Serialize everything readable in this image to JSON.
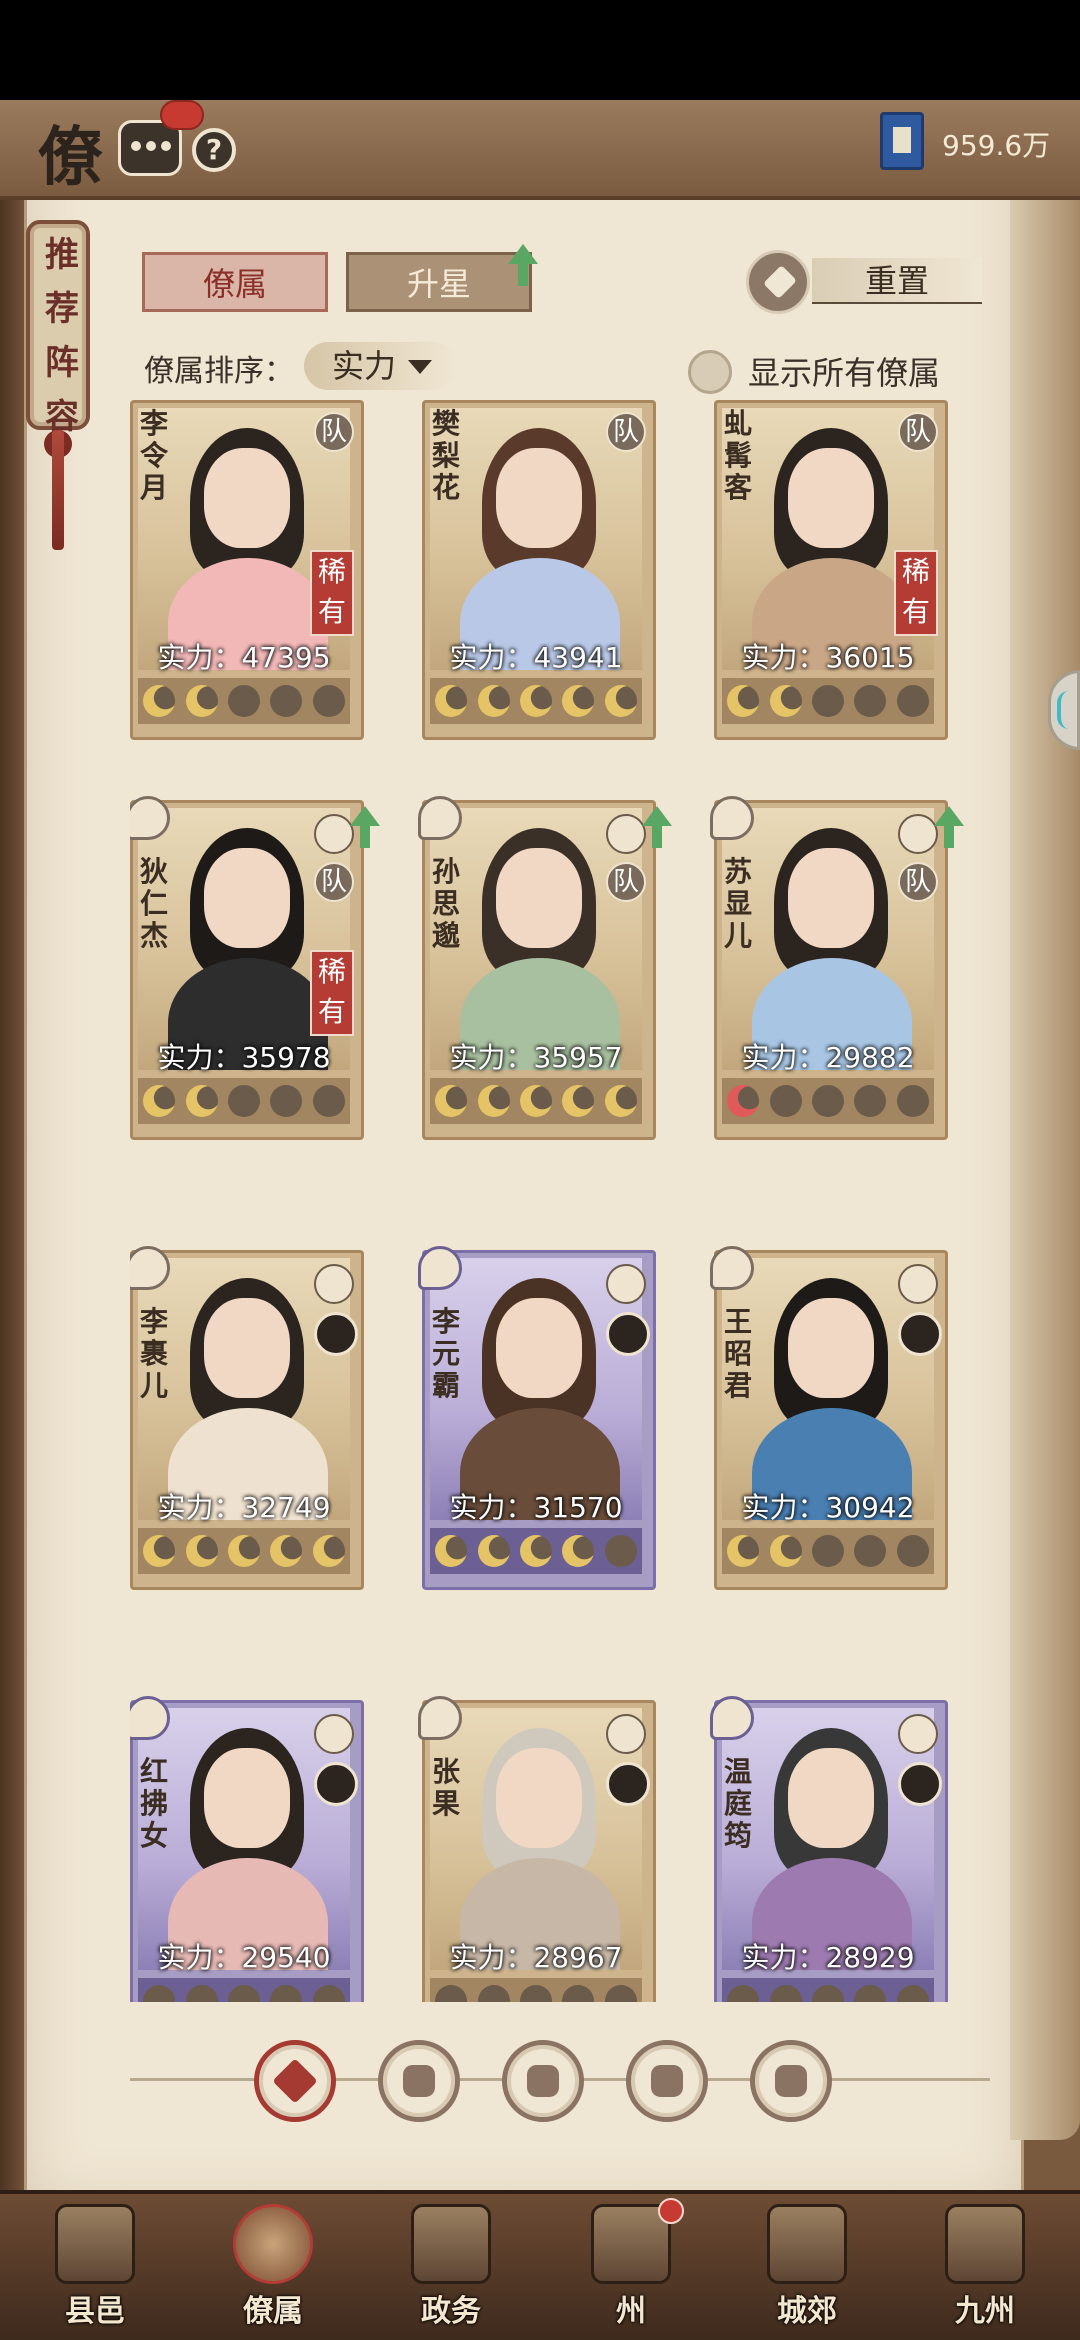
{
  "header": {
    "title": "僚",
    "currency_value": "959.6万"
  },
  "recommend_tab": {
    "chars": [
      "推",
      "荐",
      "阵",
      "容"
    ]
  },
  "tabs": {
    "active": "僚属",
    "inactive": "升星"
  },
  "reset_label": "重置",
  "sort": {
    "label": "僚属排序：",
    "value": "实力"
  },
  "show_all_label": "显示所有僚属",
  "cards": [
    {
      "name": "李令月",
      "power": "实力：47395",
      "team": "队",
      "rare": "稀有",
      "stars": [
        1,
        1,
        0,
        0,
        0
      ],
      "epic": false,
      "has_zodiac": false,
      "upgrade": false
    },
    {
      "name": "樊梨花",
      "power": "实力：43941",
      "team": "队",
      "rare": "",
      "stars": [
        1,
        1,
        1,
        1,
        1
      ],
      "epic": false,
      "has_zodiac": false,
      "upgrade": false
    },
    {
      "name": "虬髯客",
      "power": "实力：36015",
      "team": "队",
      "rare": "稀有",
      "stars": [
        1,
        1,
        0,
        0,
        0
      ],
      "epic": false,
      "has_zodiac": false,
      "upgrade": false
    },
    {
      "name": "狄仁杰",
      "power": "实力：35978",
      "team": "队",
      "rare": "稀有",
      "stars": [
        1,
        1,
        0,
        0,
        0
      ],
      "epic": false,
      "has_zodiac": true,
      "upgrade": true
    },
    {
      "name": "孙思邈",
      "power": "实力：35957",
      "team": "队",
      "rare": "",
      "stars": [
        1,
        1,
        1,
        1,
        1
      ],
      "epic": false,
      "has_zodiac": true,
      "upgrade": true
    },
    {
      "name": "苏显儿",
      "power": "实力：29882",
      "team": "队",
      "rare": "",
      "stars": [
        2,
        0,
        0,
        0,
        0
      ],
      "epic": false,
      "has_zodiac": true,
      "upgrade": true
    },
    {
      "name": "李裹儿",
      "power": "实力：32749",
      "team": "",
      "rare": "",
      "stars": [
        1,
        1,
        1,
        1,
        1
      ],
      "epic": false,
      "has_zodiac": true,
      "upgrade": false
    },
    {
      "name": "李元霸",
      "power": "实力：31570",
      "team": "",
      "rare": "",
      "stars": [
        1,
        1,
        1,
        1,
        0
      ],
      "epic": true,
      "has_zodiac": true,
      "upgrade": false
    },
    {
      "name": "王昭君",
      "power": "实力：30942",
      "team": "",
      "rare": "",
      "stars": [
        1,
        1,
        0,
        0,
        0
      ],
      "epic": false,
      "has_zodiac": true,
      "upgrade": false
    },
    {
      "name": "红拂女",
      "power": "实力：29540",
      "team": "",
      "rare": "",
      "stars": [
        0,
        0,
        0,
        0,
        0
      ],
      "epic": true,
      "has_zodiac": true,
      "upgrade": false
    },
    {
      "name": "张果",
      "power": "实力：28967",
      "team": "",
      "rare": "",
      "stars": [
        0,
        0,
        0,
        0,
        0
      ],
      "epic": false,
      "has_zodiac": true,
      "upgrade": false
    },
    {
      "name": "温庭筠",
      "power": "实力：28929",
      "team": "",
      "rare": "",
      "stars": [
        0,
        0,
        0,
        0,
        0
      ],
      "epic": true,
      "has_zodiac": true,
      "upgrade": false
    }
  ],
  "filters": [
    "all-filter-icon",
    "bell-filter-icon",
    "gourd-filter-icon",
    "fan-filter-icon",
    "lion-filter-icon"
  ],
  "bottom_nav": [
    {
      "label": "县邑",
      "icon": "county-icon"
    },
    {
      "label": "僚属",
      "icon": "retainers-icon"
    },
    {
      "label": "政务",
      "icon": "affairs-icon"
    },
    {
      "label": "州",
      "icon": "prefecture-icon"
    },
    {
      "label": "城郊",
      "icon": "suburb-icon"
    },
    {
      "label": "九州",
      "icon": "nine-states-icon"
    }
  ],
  "colors": {
    "accent_red": "#a43a32",
    "page_bg": "#efe6d3",
    "upgrade_green": "#5aa763"
  }
}
